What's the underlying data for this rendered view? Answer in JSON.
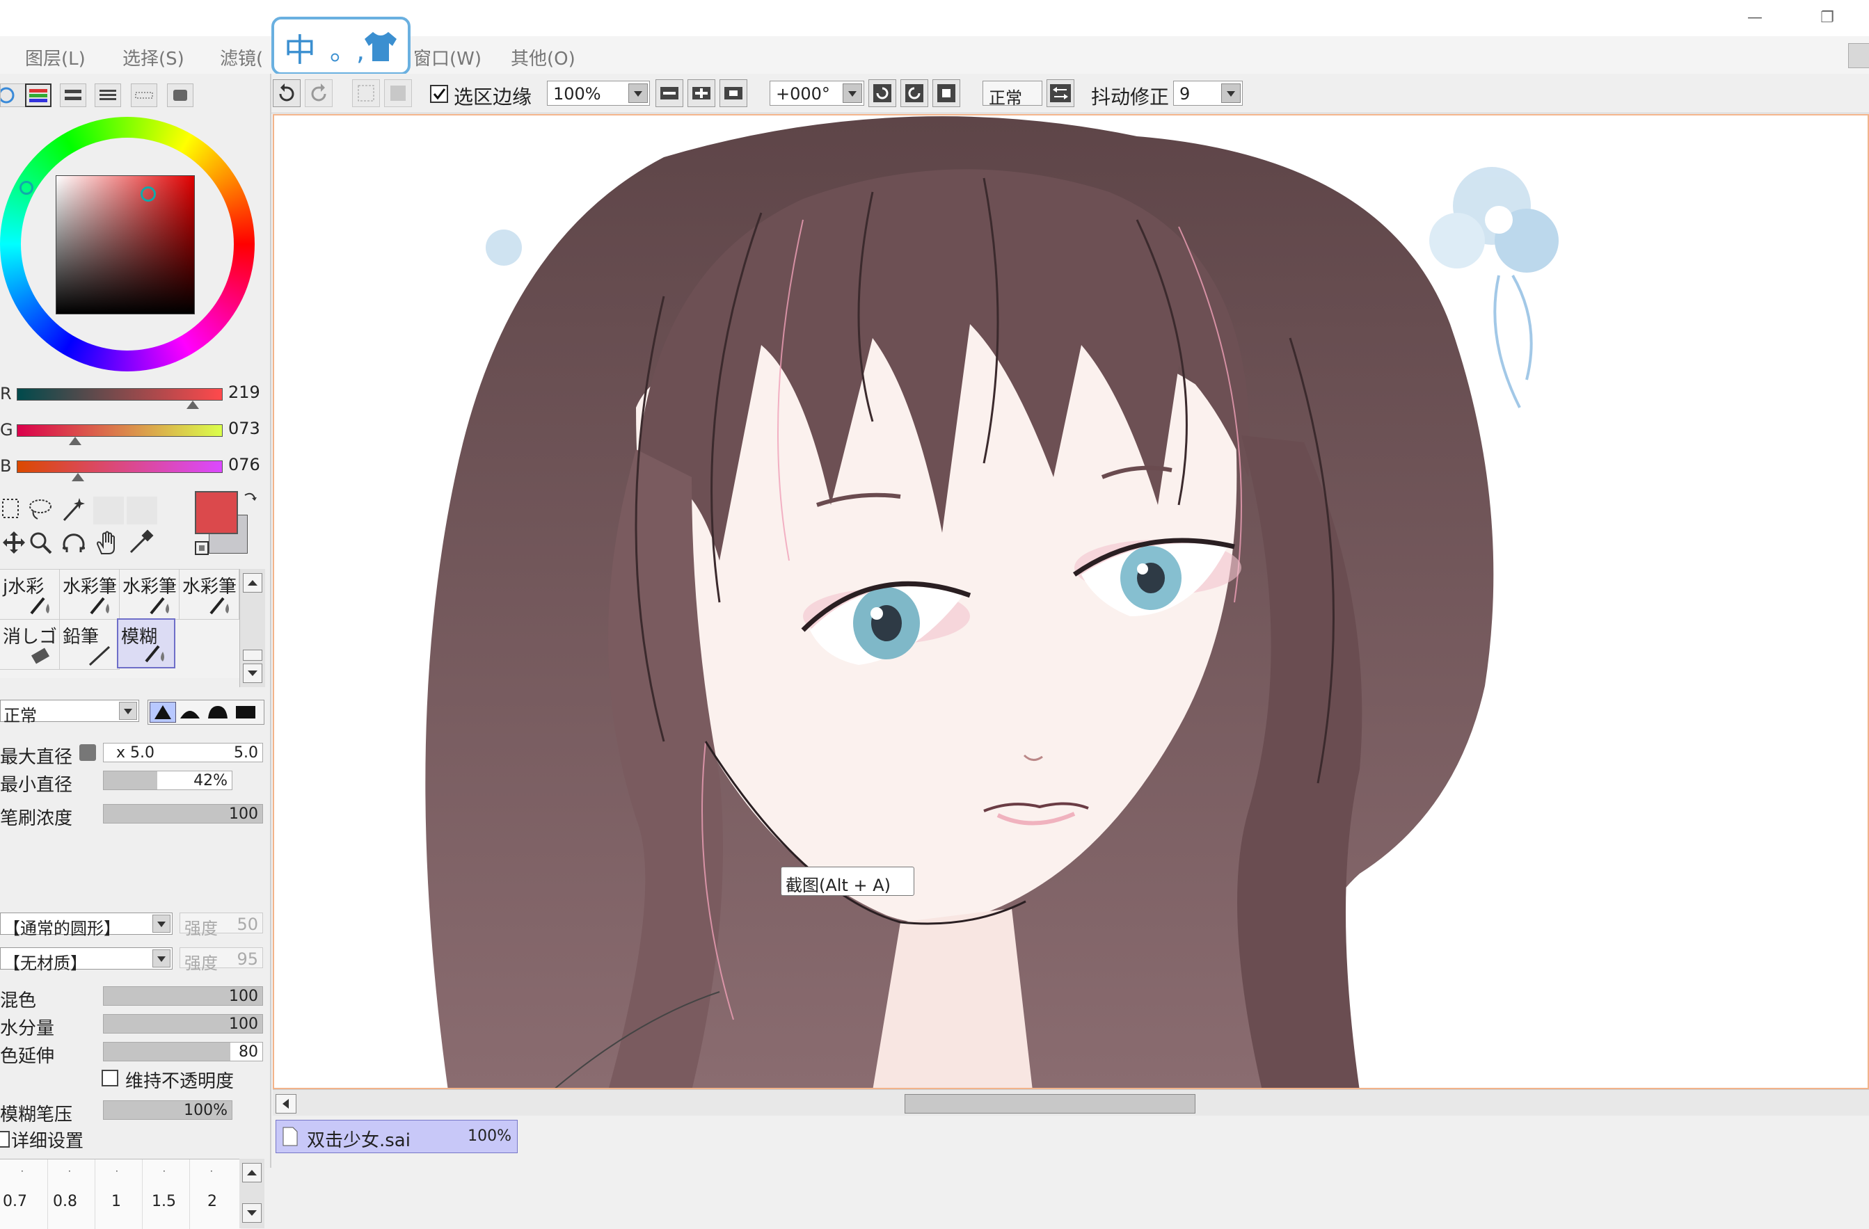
{
  "window": {
    "min_icon": "minimize-icon",
    "restore_icon": "restore-icon"
  },
  "menu": {
    "items": [
      "图层(L)",
      "选择(S)",
      "滤镜(",
      "窗口(W)",
      "其他(O)"
    ]
  },
  "ime": {
    "mode": "中",
    "punct": "。,",
    "skin_icon": "shirt-icon"
  },
  "color": {
    "r_label": "R",
    "g_label": "G",
    "b_label": "B",
    "r": "219",
    "g": "073",
    "b": "076",
    "r_fraction": 0.859,
    "g_fraction": 0.286,
    "b_fraction": 0.298,
    "primary": "#db494c",
    "secondary": "#c8c8cc"
  },
  "brushes": {
    "row1": [
      "j水彩",
      "水彩筆",
      "水彩筆",
      "水彩筆"
    ],
    "row2": [
      "消しゴ",
      "鉛筆",
      "模糊"
    ],
    "selected": "模糊"
  },
  "brush_settings": {
    "blend_mode": "正常",
    "max_diameter_label": "最大直径",
    "max_diameter_mult": "x 5.0",
    "max_diameter_value": "5.0",
    "min_diameter_label": "最小直径",
    "min_diameter_value": "42%",
    "density_label": "笔刷浓度",
    "density_value": "100",
    "shape_label": "【通常的圆形】",
    "shape_strength_label": "强度",
    "shape_strength_value": "50",
    "texture_label": "【无材质】",
    "texture_strength_label": "强度",
    "texture_strength_value": "95",
    "mix_label": "混色",
    "mix_value": "100",
    "water_label": "水分量",
    "water_value": "100",
    "stretch_label": "色延伸",
    "stretch_value": "80",
    "keep_opacity_label": "维持不透明度",
    "blur_pressure_label": "模糊笔压",
    "blur_pressure_value": "100%",
    "detail_label": "详细设置"
  },
  "brush_sizes": [
    "0.7",
    "0.8",
    "1",
    "1.5",
    "2"
  ],
  "toolbar": {
    "selection_edge_label": "选区边缘",
    "selection_edge_checked": true,
    "zoom": "100%",
    "rotation": "+000°",
    "mode": "正常",
    "stabilizer_label": "抖动修正",
    "stabilizer_value": "9"
  },
  "tooltip": {
    "text": "截图(Alt + A)"
  },
  "file_tab": {
    "name": "双击少女.sai",
    "zoom": "100%"
  }
}
